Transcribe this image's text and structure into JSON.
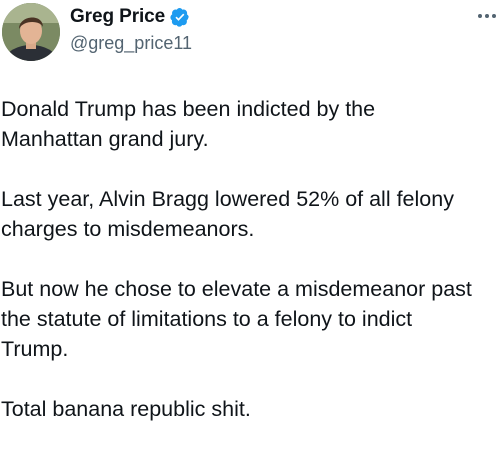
{
  "author": {
    "display_name": "Greg Price",
    "handle": "@greg_price11",
    "verified": true,
    "verified_color": "#1d9bf0"
  },
  "icons": {
    "verified": "verified-badge-icon",
    "more": "more-options-icon"
  },
  "tweet": {
    "paragraphs": [
      {
        "lines": [
          "Donald Trump has been indicted by the",
          "Manhattan grand jury."
        ]
      },
      {
        "lines": [
          "Last year, Alvin Bragg lowered 52% of all felony",
          "charges to misdemeanors."
        ]
      },
      {
        "lines": [
          "But now he chose to elevate a misdemeanor past",
          "the statute of limitations to a felony to indict",
          "Trump."
        ]
      },
      {
        "lines": [
          "Total banana republic shit."
        ]
      }
    ]
  }
}
